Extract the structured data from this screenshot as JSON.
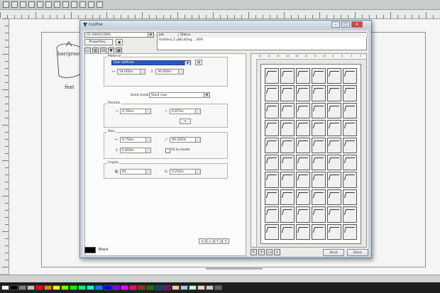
{
  "background_app": {
    "toolbar_icons": [
      "open-icon",
      "save-icon",
      "print-icon",
      "cut-icon",
      "copy-icon",
      "paste-icon",
      "undo-icon",
      "redo-icon",
      "import-icon",
      "export-icon",
      "zoom-icon",
      "help-icon"
    ],
    "canvas_text": [
      "bar/grass",
      "feat"
    ]
  },
  "dialog": {
    "title": "Cut/Plot",
    "port_select": "CE-5000/COM3",
    "properties_tab": "Properties...",
    "job_table": {
      "headers": [
        "Job",
        "Status"
      ],
      "rows": [
        [
          "Untitled_2.job",
          "Cutting....30%"
        ]
      ]
    },
    "preview_mode": "Layout Preview",
    "material": {
      "label": "Material",
      "selected": "User defined",
      "width": "24.000in",
      "height": "36.000in"
    },
    "send_mode": {
      "label": "Send mode:",
      "value": "Send now"
    },
    "position": {
      "label": "Position",
      "x": "0.781in",
      "y": "0.875in"
    },
    "size": {
      "label": "Size",
      "width": "9.750in",
      "scale": "99.326%",
      "height": "5.859in",
      "fit_label": "Fit to media"
    },
    "copies": {
      "label": "Copies",
      "count": "64",
      "spacing": "0.250in"
    },
    "color_label": "Black",
    "f_button": "F",
    "buttons": {
      "send": "Send",
      "done": "Done"
    },
    "preview": {
      "rows": 10,
      "cols": 6,
      "ruler_labels": [
        "24",
        "22",
        "20",
        "18",
        "16",
        "14",
        "12",
        "10",
        "8",
        "6",
        "4",
        "2"
      ]
    }
  },
  "palette": {
    "colors": [
      "#ffffff",
      "#000000",
      "#7f7f7f",
      "#c0c0c0",
      "#ff0000",
      "#ff8000",
      "#ffff00",
      "#80ff00",
      "#00ff00",
      "#00ff80",
      "#00ffff",
      "#0080ff",
      "#0000ff",
      "#8000ff",
      "#ff00ff",
      "#ff0080",
      "#804000",
      "#008000",
      "#004080",
      "#800080",
      "#ffcc99",
      "#99ccff",
      "#ccffcc",
      "#ffcccc",
      "#cccccc",
      "#666666"
    ]
  }
}
